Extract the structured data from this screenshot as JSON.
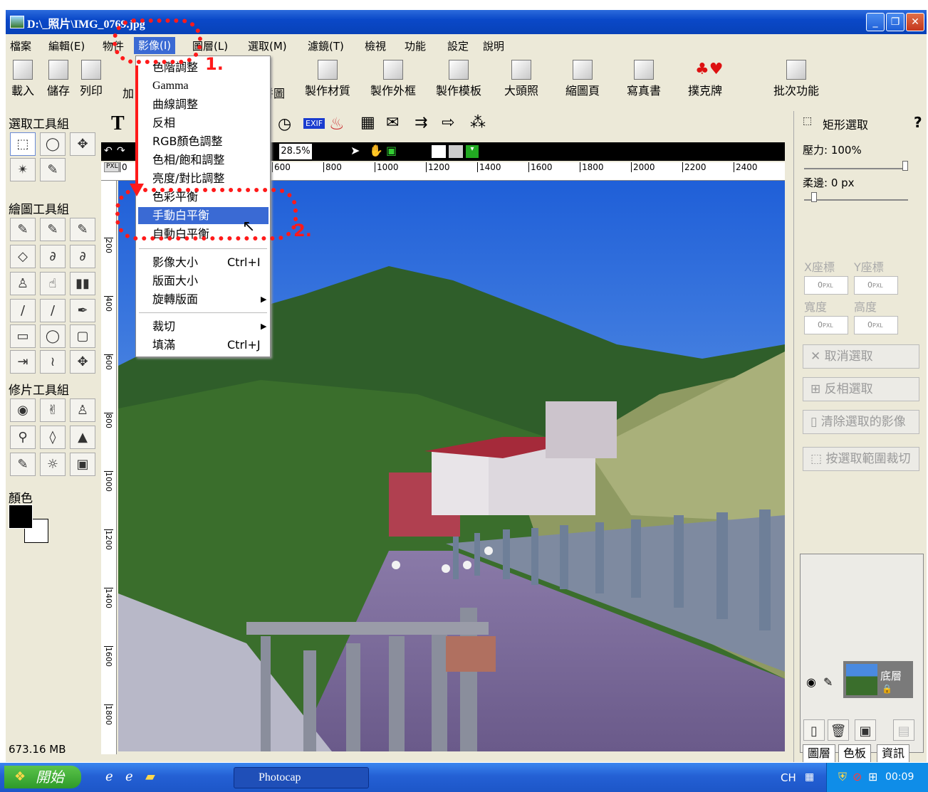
{
  "window": {
    "title": "D:\\_照片\\IMG_0769.jpg",
    "min_label": "_",
    "max_label": "❐",
    "close_label": "✕"
  },
  "menubar": [
    "檔案",
    "編輯(E)",
    "物件",
    "影像(I)",
    "圖層(L)",
    "選取(M)",
    "濾鏡(T)",
    "檢視",
    "功能",
    "設定",
    "說明"
  ],
  "toolbar": [
    {
      "label": "載入",
      "icon": "open-folder-icon"
    },
    {
      "label": "儲存",
      "icon": "save-disk-icon"
    },
    {
      "label": "列印",
      "icon": "printer-icon"
    },
    {
      "label": "加",
      "icon": "add-icon"
    },
    {
      "label": "拼圖",
      "icon": "collage-icon"
    },
    {
      "label": "製作材質",
      "icon": "texture-icon"
    },
    {
      "label": "製作外框",
      "icon": "frame-icon"
    },
    {
      "label": "製作模板",
      "icon": "template-icon"
    },
    {
      "label": "大頭照",
      "icon": "id-photo-icon"
    },
    {
      "label": "縮圖頁",
      "icon": "thumbnail-page-icon"
    },
    {
      "label": "寫真書",
      "icon": "photo-book-icon"
    },
    {
      "label": "撲克牌",
      "icon": "poker-cards-icon"
    },
    {
      "label": "批次功能",
      "icon": "batch-icon"
    }
  ],
  "tools": {
    "select_group": "選取工具組",
    "draw_group": "繪圖工具組",
    "retouch_group": "修片工具組",
    "color_label": "顏色",
    "memory": "673.16 MB"
  },
  "canvas": {
    "zoom": "28.5%",
    "ruler_unit": "PXL",
    "ruler_h": [
      "0",
      "600",
      "800",
      "1000",
      "1200",
      "1400",
      "1600",
      "1800",
      "2000",
      "2200",
      "2400"
    ],
    "ruler_v": [
      "200",
      "400",
      "600",
      "800",
      "1000",
      "1200",
      "1400",
      "1600",
      "1800"
    ]
  },
  "image_menu": {
    "items": [
      {
        "label": "色階調整"
      },
      {
        "label": "Gamma"
      },
      {
        "label": "曲線調整"
      },
      {
        "label": "反相"
      },
      {
        "label": "RGB顏色調整"
      },
      {
        "label": "色相/飽和調整"
      },
      {
        "label": "亮度/對比調整"
      },
      {
        "label": "色彩平衡"
      },
      {
        "label": "手動白平衡",
        "highlighted": true
      },
      {
        "label": "自動白平衡"
      },
      {
        "label": "影像大小",
        "shortcut": "Ctrl+I"
      },
      {
        "label": "版面大小"
      },
      {
        "label": "旋轉版面",
        "submenu": true
      },
      {
        "label": "裁切",
        "submenu": true
      },
      {
        "label": "填滿",
        "shortcut": "Ctrl+J"
      }
    ]
  },
  "annotations": {
    "step1": "1.",
    "step2": "2."
  },
  "right_panel": {
    "tool_name": "矩形選取",
    "help": "?",
    "pressure": "壓力: 100%",
    "feather": "柔邊: 0 px",
    "x_label": "X座標",
    "y_label": "Y座標",
    "w_label": "寬度",
    "h_label": "高度",
    "coord_value": "0",
    "coord_unit": "PXL",
    "cancel_selection": "取消選取",
    "invert_selection": "反相選取",
    "clear_selection": "清除選取的影像",
    "crop_selection": "按選取範圍裁切",
    "layer_name": "底層",
    "tabs": [
      "圖層",
      "色板",
      "資訊"
    ]
  },
  "taskbar": {
    "start": "開始",
    "task": "Photocap",
    "lang": "CH",
    "clock": "00:09"
  },
  "colors": {
    "annotation": "#ff1a1a",
    "highlight": "#3a6ad4",
    "titlebar": "#0a48c8"
  }
}
